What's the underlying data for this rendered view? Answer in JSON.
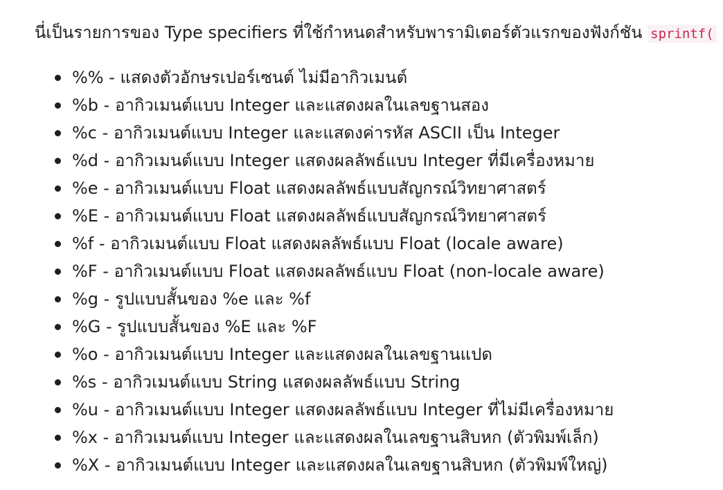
{
  "intro": {
    "text": "นี่เป็นรายการของ Type specifiers ที่ใช้กำหนดสำหรับพารามิเตอร์ตัวแรกของฟังก์ชัน",
    "code": "sprintf("
  },
  "items": [
    {
      "text": "%% - แสดงตัวอักษรเปอร์เซนต์ ไม่มีอากิวเมนต์"
    },
    {
      "text": "%b - อากิวเมนต์แบบ Integer และแสดงผลในเลขฐานสอง"
    },
    {
      "text": "%c - อากิวเมนต์แบบ Integer และแสดงค่ารหัส ASCII เป็น Integer"
    },
    {
      "text": "%d - อากิวเมนต์แบบ Integer แสดงผลลัพธ์แบบ Integer ที่มีเครื่องหมาย"
    },
    {
      "text": "%e - อากิวเมนต์แบบ Float แสดงผลลัพธ์แบบสัญกรณ์วิทยาศาสตร์"
    },
    {
      "text": "%E - อากิวเมนต์แบบ Float แสดงผลลัพธ์แบบสัญกรณ์วิทยาศาสตร์"
    },
    {
      "text": "%f - อากิวเมนต์แบบ Float แสดงผลลัพธ์แบบ Float (locale aware)"
    },
    {
      "text": "%F - อากิวเมนต์แบบ Float แสดงผลลัพธ์แบบ Float (non-locale aware)"
    },
    {
      "text": "%g - รูปแบบสั้นของ %e และ %f"
    },
    {
      "text": "%G - รูปแบบสั้นของ %E และ %F"
    },
    {
      "text": "%o - อากิวเมนต์แบบ Integer และแสดงผลในเลขฐานแปด"
    },
    {
      "text": "%s - อากิวเมนต์แบบ String แสดงผลลัพธ์แบบ String"
    },
    {
      "text": "%u - อากิวเมนต์แบบ Integer แสดงผลลัพธ์แบบ Integer ที่ไม่มีเครื่องหมาย"
    },
    {
      "text": "%x - อากิวเมนต์แบบ Integer และแสดงผลในเลขฐานสิบหก (ตัวพิมพ์เล็ก)"
    },
    {
      "text": "%X - อากิวเมนต์แบบ Integer และแสดงผลในเลขฐานสิบหก (ตัวพิมพ์ใหญ่)"
    }
  ]
}
